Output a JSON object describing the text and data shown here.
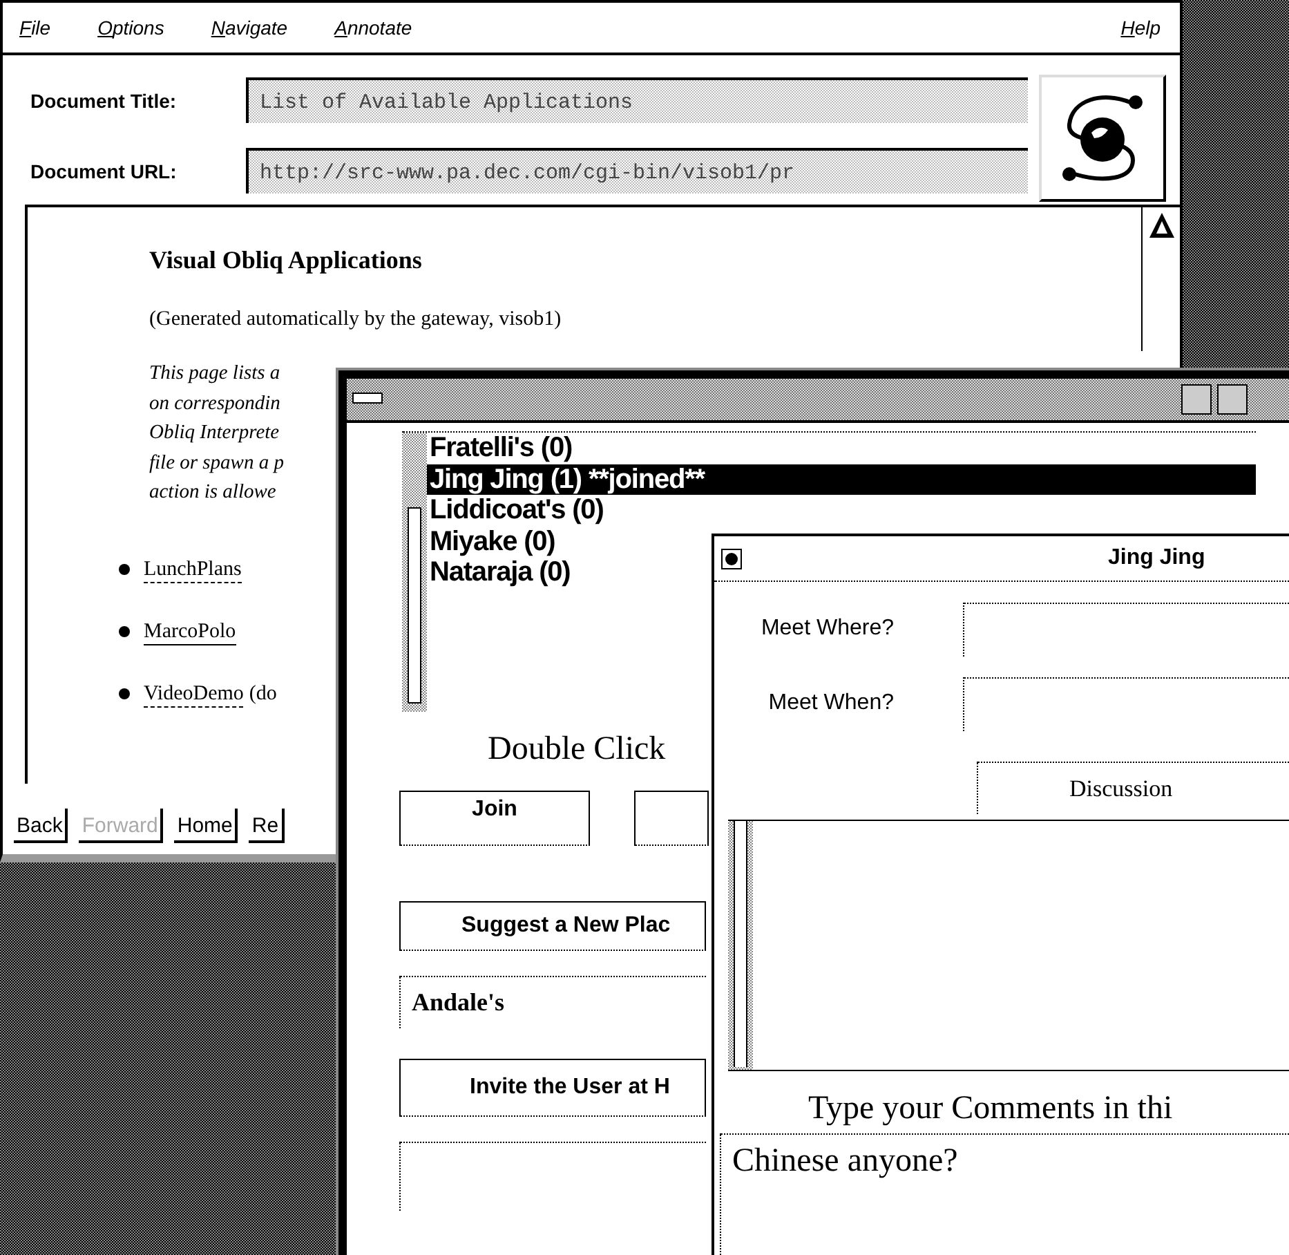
{
  "browser": {
    "menu": [
      {
        "label": "File"
      },
      {
        "label": "Options"
      },
      {
        "label": "Navigate"
      },
      {
        "label": "Annotate"
      }
    ],
    "help": "Help",
    "fields": [
      {
        "label": "Document Title:",
        "value": "List of Available Applications"
      },
      {
        "label": "Document URL:",
        "value": "http://src-www.pa.dec.com/cgi-bin/visob1/pr"
      }
    ],
    "heading": "Visual Obliq Applications",
    "note": "(Generated automatically by the gateway, visob1)",
    "intro_lines": [
      "This page lists a",
      "on correspondin",
      "Obliq Interprete",
      "file or spawn a p",
      "action is allowe"
    ],
    "links": [
      {
        "label": "LunchPlans",
        "visited": false
      },
      {
        "label": "MarcoPolo",
        "visited": true
      },
      {
        "label": "VideoDemo",
        "visited": false,
        "after": "(do"
      }
    ],
    "buttons": [
      {
        "label": "Back",
        "disabled": false
      },
      {
        "label": "Forward",
        "disabled": true
      },
      {
        "label": "Home",
        "disabled": false
      },
      {
        "label": "Re",
        "disabled": false
      }
    ]
  },
  "places_window": {
    "places": [
      {
        "label": "Fratelli's (0)",
        "selected": false
      },
      {
        "label": "Jing Jing (1) **joined**",
        "selected": true
      },
      {
        "label": "Liddicoat's (0)",
        "selected": false
      },
      {
        "label": "Miyake (0)",
        "selected": false
      },
      {
        "label": "Nataraja (0)",
        "selected": false
      }
    ],
    "instruction": "Double Click",
    "action_buttons": [
      {
        "label": "Join"
      }
    ],
    "suggest_button": "Suggest a New Plac",
    "place_field": {
      "value": "Andale's"
    },
    "invite_button": "Invite the User at H"
  },
  "chat_window": {
    "title": "Jing Jing",
    "fields": [
      {
        "label": "Meet Where?"
      },
      {
        "label": "Meet When?"
      }
    ],
    "tab": "Discussion",
    "prompt": "Type your Comments in thi",
    "comment_field": {
      "value": "Chinese anyone?"
    }
  }
}
